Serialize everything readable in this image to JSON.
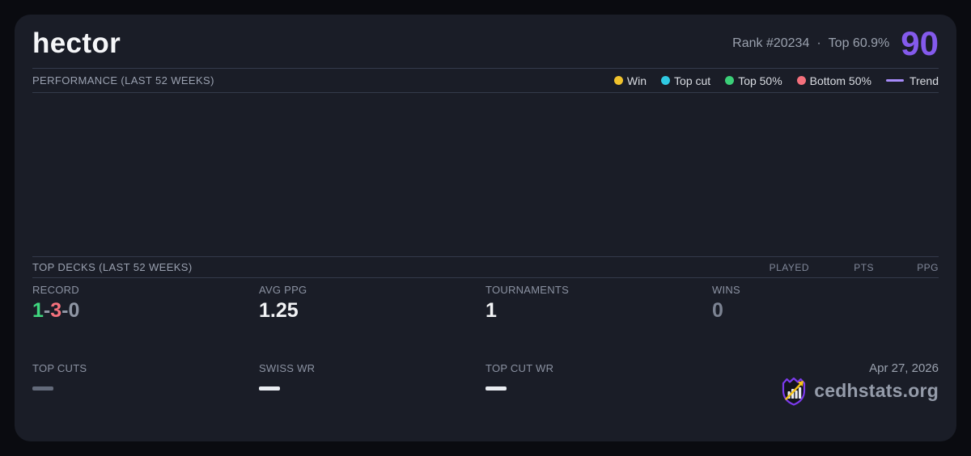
{
  "header": {
    "player_name": "hector",
    "rank_text": "Rank #20234",
    "separator": "·",
    "top_percent_text": "Top 60.9%",
    "score": "90",
    "score_color": "#845aec"
  },
  "performance": {
    "title": "PERFORMANCE (LAST 52 WEEKS)",
    "legend": [
      {
        "label": "Win",
        "color": "#f0c22c",
        "type": "dot"
      },
      {
        "label": "Top cut",
        "color": "#2fc9e2",
        "type": "dot"
      },
      {
        "label": "Top 50%",
        "color": "#3bcf78",
        "type": "dot"
      },
      {
        "label": "Bottom 50%",
        "color": "#f4707c",
        "type": "dot"
      },
      {
        "label": "Trend",
        "color": "#a78bfa",
        "type": "line"
      }
    ],
    "chart_empty": true
  },
  "top_decks": {
    "title": "TOP DECKS (LAST 52 WEEKS)",
    "columns": [
      "PLAYED",
      "PTS",
      "PPG"
    ],
    "rows": []
  },
  "stats": {
    "record": {
      "label": "RECORD",
      "wins": "1",
      "losses": "3",
      "draws": "0",
      "separator": "-",
      "wins_color": "#3fd67e",
      "losses_color": "#f4717c",
      "draws_color": "#8f96a4"
    },
    "avg_ppg": {
      "label": "AVG PPG",
      "value": "1.25"
    },
    "tournaments": {
      "label": "TOURNAMENTS",
      "value": "1"
    },
    "wins": {
      "label": "WINS",
      "value": "0"
    },
    "top_cuts": {
      "label": "TOP CUTS",
      "value": "—"
    },
    "swiss_wr": {
      "label": "SWISS WR",
      "value": "—"
    },
    "top_cut_wr": {
      "label": "TOP CUT WR",
      "value": "—"
    }
  },
  "footer": {
    "date": "Apr 27, 2026",
    "brand": "cedhstats.org"
  }
}
